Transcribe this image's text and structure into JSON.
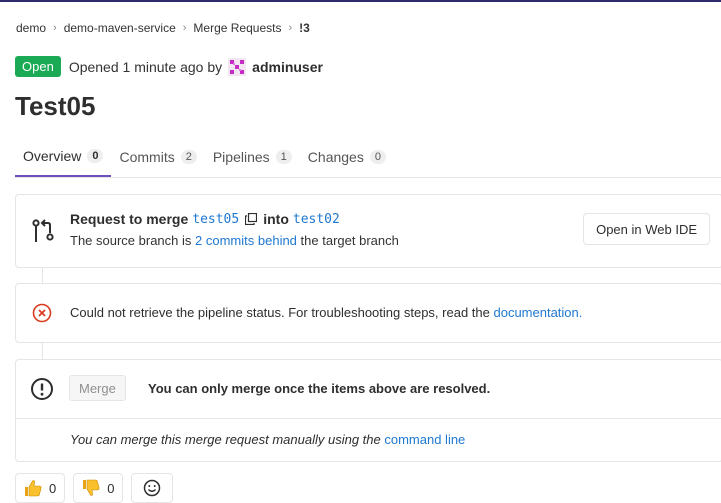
{
  "breadcrumb": {
    "items": [
      "demo",
      "demo-maven-service",
      "Merge Requests",
      "!3"
    ]
  },
  "status": {
    "badge": "Open",
    "opened_text": "Opened 1 minute ago by",
    "author": "adminuser",
    "badge_color": "#1aaa55"
  },
  "title": "Test05",
  "tabs": [
    {
      "label": "Overview",
      "count": "0",
      "active": true
    },
    {
      "label": "Commits",
      "count": "2",
      "active": false
    },
    {
      "label": "Pipelines",
      "count": "1",
      "active": false
    },
    {
      "label": "Changes",
      "count": "0",
      "active": false
    }
  ],
  "merge_request": {
    "prefix": "Request to merge",
    "source_branch": "test05",
    "into": "into",
    "target_branch": "test02",
    "behind_prefix": "The source branch is",
    "behind_link": "2 commits behind",
    "behind_suffix": "the target branch",
    "web_ide_button": "Open in Web IDE"
  },
  "pipeline": {
    "message": "Could not retrieve the pipeline status. For troubleshooting steps, read the",
    "link": "documentation",
    "suffix": "."
  },
  "merge": {
    "button": "Merge",
    "message": "You can only merge once the items above are resolved.",
    "manual_text": "You can merge this merge request manually using the",
    "manual_link": "command line"
  },
  "awards": {
    "thumbsup_count": "0",
    "thumbsdown_count": "0"
  },
  "colors": {
    "accent": "#6b4fbb",
    "link": "#1f78d1",
    "error": "#db3b21"
  }
}
